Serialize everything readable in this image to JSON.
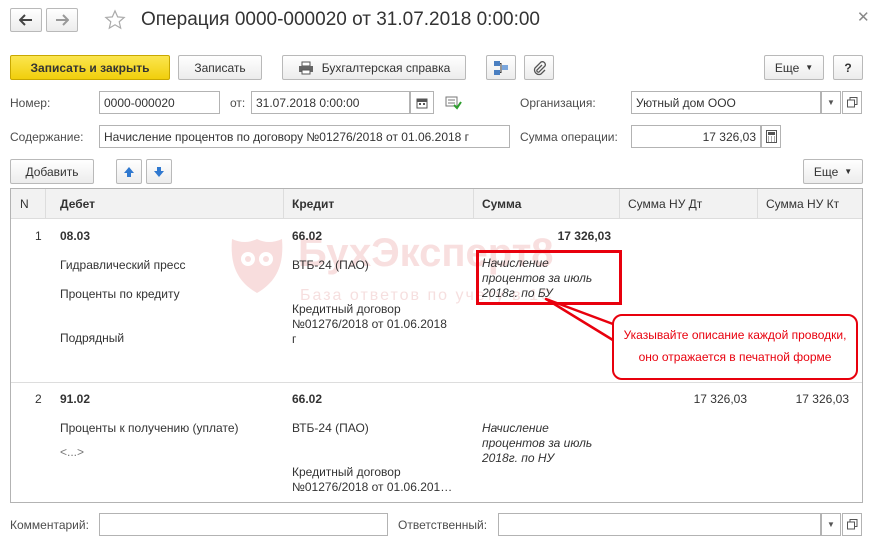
{
  "nav": {
    "back_icon": "arrow-left-icon",
    "forward_icon": "arrow-right-icon",
    "favorite_icon": "star-icon",
    "close_icon": "close-icon"
  },
  "title": "Операция 0000-000020 от 31.07.2018 0:00:00",
  "toolbar": {
    "save_close": "Записать и закрыть",
    "save": "Записать",
    "accounting_note": "Бухгалтерская справка",
    "more": "Еще",
    "help": "?"
  },
  "form": {
    "number_label": "Номер:",
    "number_value": "0000-000020",
    "date_label": "от:",
    "date_value": "31.07.2018  0:00:00",
    "org_label": "Организация:",
    "org_value": "Уютный дом ООО",
    "content_label": "Содержание:",
    "content_value": "Начисление процентов по договору №01276/2018 от 01.06.2018 г",
    "sum_label": "Сумма операции:",
    "sum_value": "17 326,03"
  },
  "table_toolbar": {
    "add": "Добавить",
    "more": "Еще"
  },
  "table": {
    "columns": [
      "N",
      "Дебет",
      "Кредит",
      "Сумма",
      "Сумма НУ Дт",
      "Сумма НУ Кт"
    ],
    "rows": [
      {
        "n": "1",
        "debit": "08.03",
        "debit_sub": [
          "Гидравлический пресс",
          "Проценты по кредиту",
          "Подрядный"
        ],
        "credit": "66.02",
        "credit_sub1": "ВТБ-24 (ПАО)",
        "credit_sub2": [
          "Кредитный договор",
          "№01276/2018 от 01.06.2018",
          "г"
        ],
        "sum": "17 326,03",
        "description": [
          "Начисление",
          "процентов за июль",
          "2018г. по БУ"
        ],
        "nu_dt": "",
        "nu_kt": ""
      },
      {
        "n": "2",
        "debit": "91.02",
        "debit_sub": [
          "Проценты к получению (уплате)",
          "<...>"
        ],
        "credit": "66.02",
        "credit_sub1": "ВТБ-24 (ПАО)",
        "credit_sub2": [
          "Кредитный договор",
          "№01276/2018 от 01.06.201…"
        ],
        "sum": "",
        "description": [
          "Начисление",
          "процентов за июль",
          "2018г. по НУ"
        ],
        "nu_dt": "17 326,03",
        "nu_kt": "17 326,03"
      }
    ]
  },
  "callout": [
    "Указывайте описание каждой проводки,",
    "оно отражается в печатной форме"
  ],
  "watermark": {
    "title": "БухЭксперт8",
    "subtitle": "База ответов по учету в 1С"
  },
  "footer": {
    "comment_label": "Комментарий:",
    "comment_value": "",
    "responsible_label": "Ответственный:",
    "responsible_value": ""
  },
  "colors": {
    "primary_button": "#f7d92b",
    "highlight": "#e8000d",
    "watermark": "#f3c8c8"
  }
}
